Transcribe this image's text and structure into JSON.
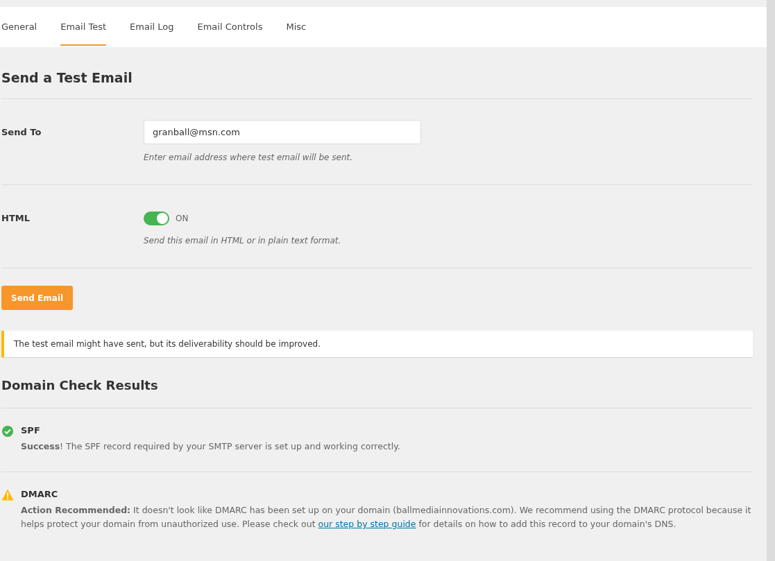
{
  "tabs": [
    {
      "label": "General",
      "selected": false
    },
    {
      "label": "Email Test",
      "selected": true
    },
    {
      "label": "Email Log",
      "selected": false
    },
    {
      "label": "Email Controls",
      "selected": false
    },
    {
      "label": "Misc",
      "selected": false
    }
  ],
  "heading": "Send a Test Email",
  "fields": [
    {
      "kind": "text",
      "label": "Send To",
      "value": "granball@msn.com",
      "hint": "Enter email address where test email will be sent."
    },
    {
      "kind": "toggle",
      "label": "HTML",
      "on": true,
      "state_label": "ON",
      "hint": "Send this email in HTML or in plain text format."
    }
  ],
  "send_button": "Send Email",
  "notice": "The test email might have sent, but its deliverability should be improved.",
  "results_heading": "Domain Check Results",
  "checks": [
    {
      "kind": "success",
      "name": "SPF",
      "text": "**Success**! The SPF record required by your SMTP server is set up and working correctly."
    },
    {
      "kind": "warning",
      "name": "DMARC",
      "text": "**Action Recommended:** It doesn't look like DMARC has been set up on your domain (ballmediainnovations.com). We recommend using the DMARC protocol because it helps protect your domain from unauthorized use. Please check out ",
      "link": "our step by step guide",
      "text_after": " for details on how to add this record to your domain's DNS."
    }
  ]
}
